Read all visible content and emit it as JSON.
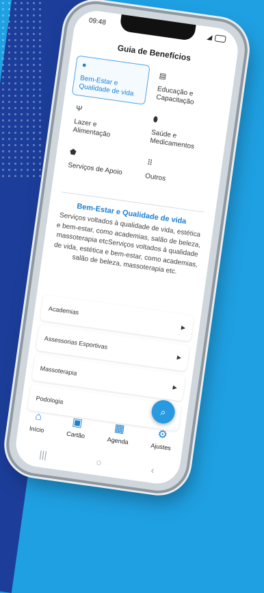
{
  "status": {
    "time": "09:48"
  },
  "header": {
    "title": "Guia de Benefícios"
  },
  "categories": [
    {
      "label": "Bem-Estar e Qualidade de vida",
      "icon": "person-icon",
      "selected": true
    },
    {
      "label": "Educação e Capacitação",
      "icon": "chat-icon",
      "selected": false
    },
    {
      "label": "Lazer e Alimentação",
      "icon": "cutlery-icon",
      "selected": false
    },
    {
      "label": "Saúde e Medicamentos",
      "icon": "pill-icon",
      "selected": false
    },
    {
      "label": "Serviços de Apoio",
      "icon": "shield-icon",
      "selected": false
    },
    {
      "label": "Outros",
      "icon": "grid-icon",
      "selected": false
    }
  ],
  "description": {
    "title": "Bem-Estar e Qualidade de vida",
    "text": "Serviços voltados à qualidade de vida, estética e bem-estar, como academias, salão de beleza, massoterapia etcServiços voltados à qualidade de vida, estética e bem-estar, como academias, salão de beleza, massoterapia etc."
  },
  "list": [
    {
      "label": "Academias"
    },
    {
      "label": "Assessorias Esportivas"
    },
    {
      "label": "Massoterapia"
    },
    {
      "label": "Podologia"
    }
  ],
  "nav": [
    {
      "label": "Início",
      "icon": "home-icon"
    },
    {
      "label": "Cartão",
      "icon": "card-icon"
    },
    {
      "label": "Agenda",
      "icon": "calendar-icon"
    },
    {
      "label": "Ajustes",
      "icon": "gear-icon"
    }
  ],
  "colors": {
    "accent": "#1a7fd4",
    "fab": "#2a9ae0",
    "background": "#1fa0e2"
  }
}
